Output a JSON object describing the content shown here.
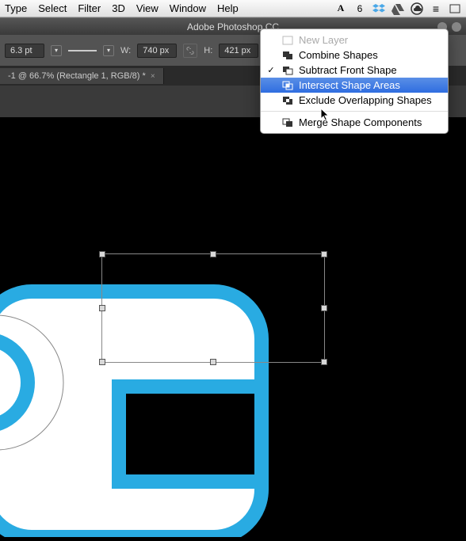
{
  "menubar": {
    "items": [
      "Type",
      "Select",
      "Filter",
      "3D",
      "View",
      "Window",
      "Help"
    ],
    "right_badge": "6"
  },
  "app": {
    "title": "Adobe Photoshop CC"
  },
  "optionsbar": {
    "stroke_width": "6.3 pt",
    "w_label": "W:",
    "w_value": "740 px",
    "h_label": "H:",
    "h_value": "421 px"
  },
  "doctab": {
    "label": "-1 @ 66.7% (Rectangle 1, RGB/8) *",
    "close": "×"
  },
  "dropdown": {
    "items": [
      {
        "label": "New Layer",
        "disabled": true,
        "checked": false
      },
      {
        "label": "Combine Shapes",
        "disabled": false,
        "checked": false
      },
      {
        "label": "Subtract Front Shape",
        "disabled": false,
        "checked": true
      },
      {
        "label": "Intersect Shape Areas",
        "disabled": false,
        "checked": false,
        "selected": true
      },
      {
        "label": "Exclude Overlapping Shapes",
        "disabled": false,
        "checked": false
      }
    ],
    "footer": {
      "label": "Merge Shape Components"
    }
  }
}
